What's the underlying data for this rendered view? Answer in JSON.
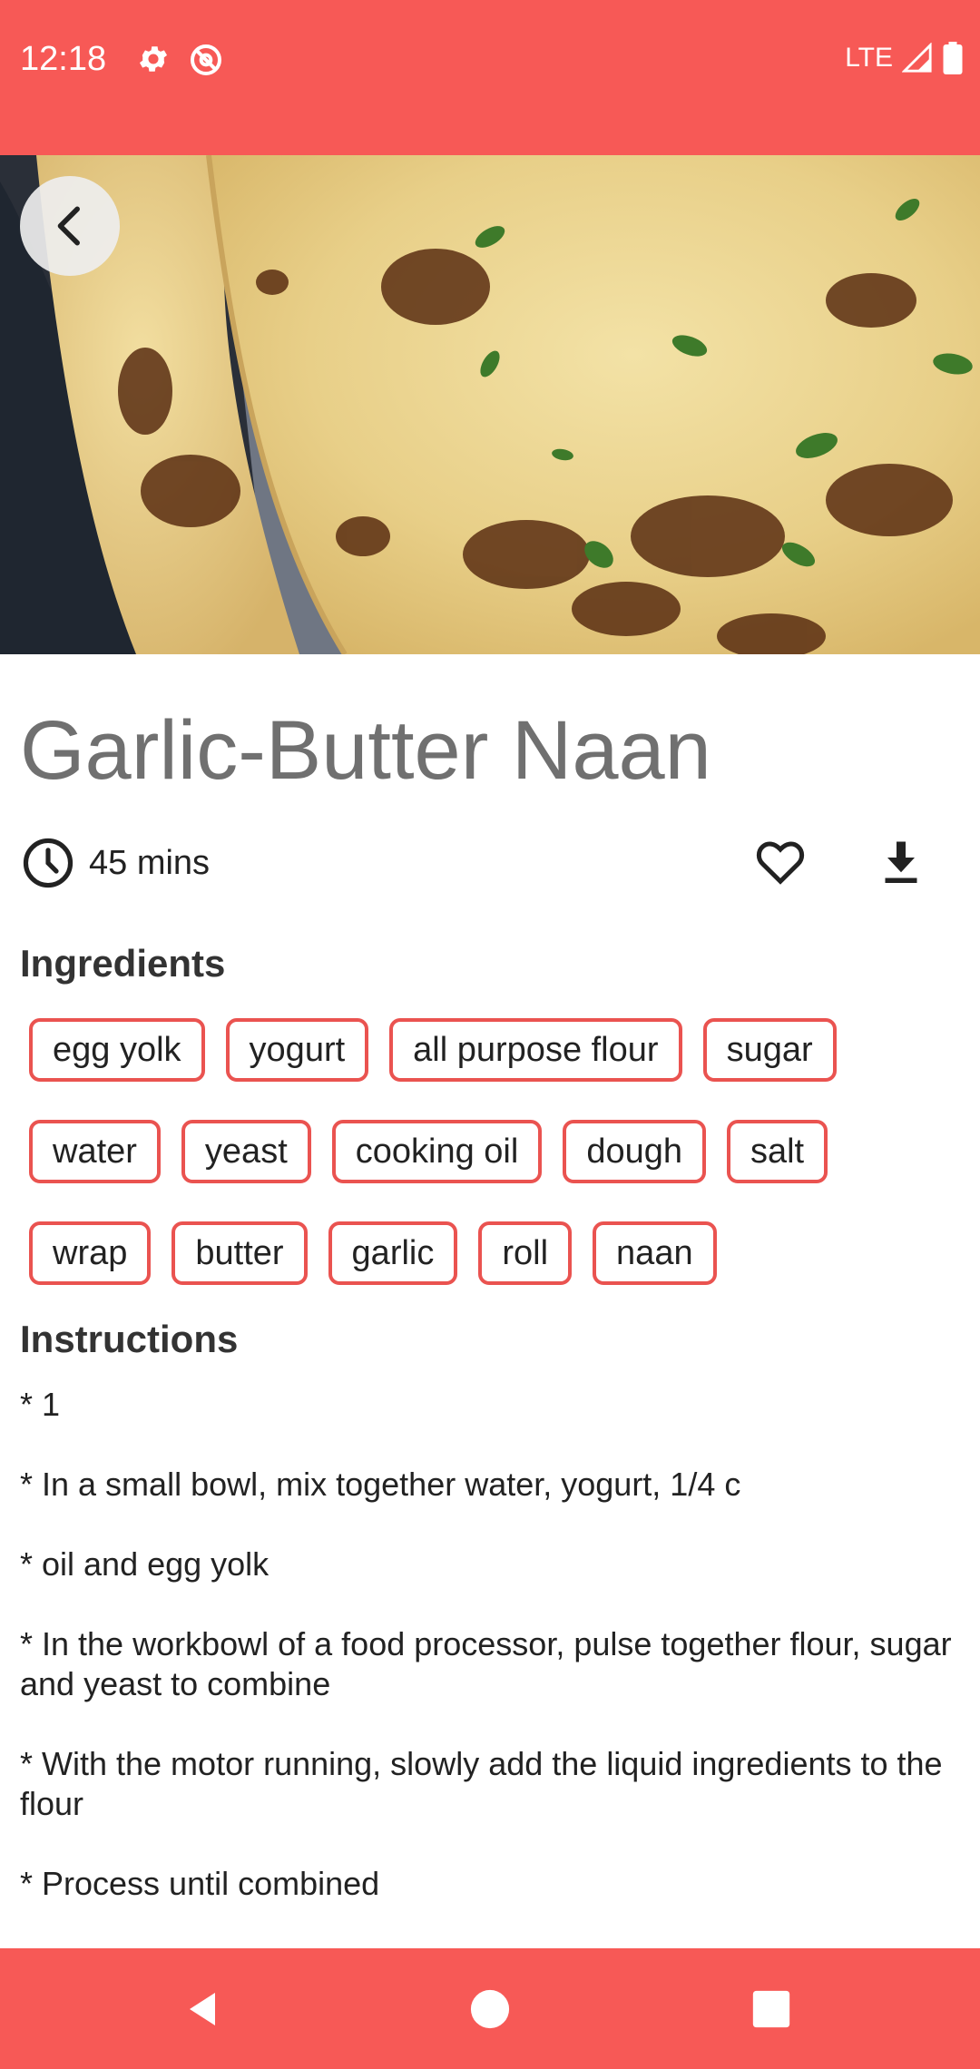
{
  "status_bar": {
    "time": "12:18",
    "network": "LTE"
  },
  "recipe": {
    "title": "Garlic-Butter Naan",
    "duration": "45 mins",
    "ingredients_heading": "Ingredients",
    "ingredients": [
      "egg yolk",
      "yogurt",
      "all purpose flour",
      "sugar",
      "water",
      "yeast",
      "cooking oil",
      "dough",
      "salt",
      "wrap",
      "butter",
      "garlic",
      "roll",
      "naan"
    ],
    "instructions_heading": "Instructions",
    "instructions": [
      "* 1",
      "* In a small bowl, mix together water, yogurt, 1/4 c",
      "* oil and egg yolk",
      "* In the workbowl of a food processor, pulse together flour, sugar and yeast to combine",
      "* With the motor running, slowly add the liquid ingredients to the flour",
      "* Process until combined"
    ]
  },
  "icons": {
    "back": "chevron-left-icon",
    "time": "clock-icon",
    "favorite": "heart-outline-icon",
    "download": "download-icon"
  },
  "colors": {
    "accent": "#f75956",
    "chip_border": "#ea5350",
    "title": "#707070"
  }
}
